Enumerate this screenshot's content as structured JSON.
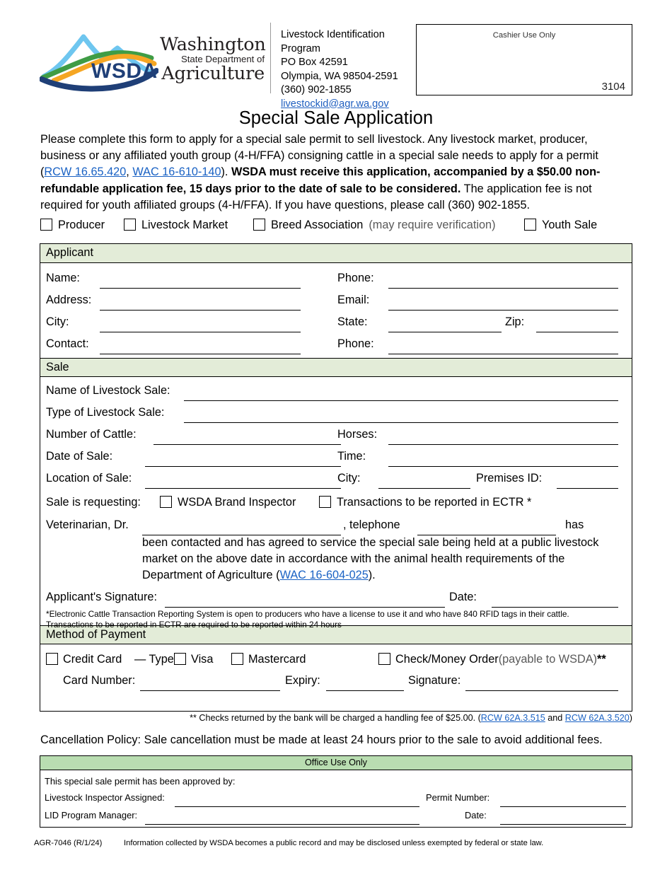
{
  "header": {
    "logo_alt": "Washington State Department of Agriculture",
    "logo_word_1": "Washington",
    "logo_word_2": "State Department of",
    "logo_word_3": "Agriculture",
    "logo_mark_text": "WSDA",
    "address_lines": [
      "Livestock Identification Program",
      "PO Box 42591",
      "Olympia, WA  98504-2591",
      "(360) 902-1855"
    ],
    "email": "livestockid@agr.wa.gov",
    "cashier_label": "Cashier Use Only",
    "cashier_number": "3104"
  },
  "title": "Special Sale Application",
  "intro": {
    "p1": "Please complete this form to apply for a special sale permit to sell livestock.  Any livestock market, producer, business or any affiliated youth group (4-H/FFA) consigning cattle in a special sale needs to apply for a permit (",
    "link1": "RCW 16.65.420",
    "sep1": ", ",
    "link2": "WAC 16-610-140",
    "p2": ").  ",
    "bold1": "WSDA must receive this application, accompanied by a $50.00 non-refundable application fee, 15 days prior to the date of sale to be considered.",
    "p3": "  The application fee is not required for youth affiliated groups (4-H/FFA).  If you have questions, please call (360) 902-1855."
  },
  "applicant_types": [
    {
      "label": "Producer",
      "note": ""
    },
    {
      "label": "Livestock Market",
      "note": ""
    },
    {
      "label": "Breed Association",
      "note": "(may require verification)"
    },
    {
      "label": "Youth Sale",
      "note": ""
    }
  ],
  "applicant": {
    "section_title": "Applicant",
    "labels": {
      "name": "Name:",
      "phone1": "Phone:",
      "address": "Address:",
      "email": "Email:",
      "city": "City:",
      "state": "State:",
      "zip": "Zip:",
      "contact": "Contact:",
      "phone2": "Phone:"
    },
    "values": {
      "name": "",
      "phone1": "",
      "address": "",
      "email": "",
      "city": "",
      "state": "",
      "zip": "",
      "contact": "",
      "phone2": ""
    }
  },
  "sale": {
    "section_title": "Sale",
    "labels": {
      "name_of_sale": "Name of Livestock Sale:",
      "type_of_sale": "Type of Livestock Sale:",
      "cattle": "Number of Cattle:",
      "horses": "Horses:",
      "date": "Date of Sale:",
      "time": "Time:",
      "location": "Location of Sale:",
      "city": "City:",
      "premises": "Premises ID:",
      "requesting": "Sale is requesting:",
      "brand_inspector": "WSDA Brand Inspector",
      "ectr": "Transactions to be reported in ECTR *",
      "vet": "Veterinarian, Dr.",
      "telephone": ", telephone",
      "has": "has",
      "signature": "Applicant's Signature:",
      "sig_date": "Date:"
    },
    "values": {
      "name_of_sale": "",
      "type_of_sale": "",
      "cattle": "",
      "horses": "",
      "date": "",
      "time": "",
      "location": "",
      "city": "",
      "premises": "",
      "vet_name": "",
      "vet_phone": "",
      "signature": "",
      "sig_date": ""
    },
    "vet_paragraph_1": "been contacted and has agreed to service the special sale being held at a public livestock",
    "vet_paragraph_2": "market on the above date in accordance with the animal health requirements of the",
    "vet_paragraph_3_pre": "Department of Agriculture (",
    "vet_paragraph_3_link": "WAC 16-604-025",
    "vet_paragraph_3_post": ").",
    "footnote_1": "*Electronic Cattle Transaction Reporting System is open to producers who have a license to use it and who have 840 RFID tags in their cattle.",
    "footnote_2": " Transactions to be reported in ECTR are required to be reported within 24 hours"
  },
  "payment": {
    "section_title": "Method of Payment",
    "credit_card": "Credit Card",
    "dash_type": "— Type:",
    "visa": "Visa",
    "mastercard": "Mastercard",
    "check": "Check/Money Order",
    "check_note": "(payable to WSDA)",
    "check_asterisk": "**",
    "card_number": "Card Number:",
    "expiry": "Expiry:",
    "signature": "Signature:",
    "values": {
      "card_number": "",
      "expiry": "",
      "signature": ""
    }
  },
  "checks_note": {
    "pre": "** Checks returned by the bank will be charged a handling fee of $25.00. (",
    "link1": "RCW 62A.3.515",
    "mid": " and ",
    "link2": "RCW 62A.3.520",
    "post": ")"
  },
  "cancellation": "Cancellation Policy: Sale cancellation must be made at least 24 hours prior to the sale to avoid additional fees.",
  "office": {
    "section_title": "Office Use Only",
    "approved_by": "This special sale permit has been approved by:",
    "inspector": "Livestock Inspector Assigned:",
    "permit_number": "Permit Number:",
    "manager": "LID Program Manager:",
    "date": "Date:",
    "values": {
      "inspector": "",
      "permit_number": "",
      "manager": "",
      "date": ""
    }
  },
  "footer": {
    "form_code": "AGR-7046 (R/1/24)",
    "disclosure": "Information collected by WSDA becomes a public record and may be disclosed unless exempted by federal or state law."
  },
  "colors": {
    "section_header_green": "#e3ecd8",
    "office_header_green": "#b9ddb1",
    "link_blue": "#1a62c4",
    "logo_sky": "#6ec6ef",
    "logo_green": "#3f9c45",
    "logo_orange": "#f5a623",
    "logo_navy": "#1f3f77"
  }
}
